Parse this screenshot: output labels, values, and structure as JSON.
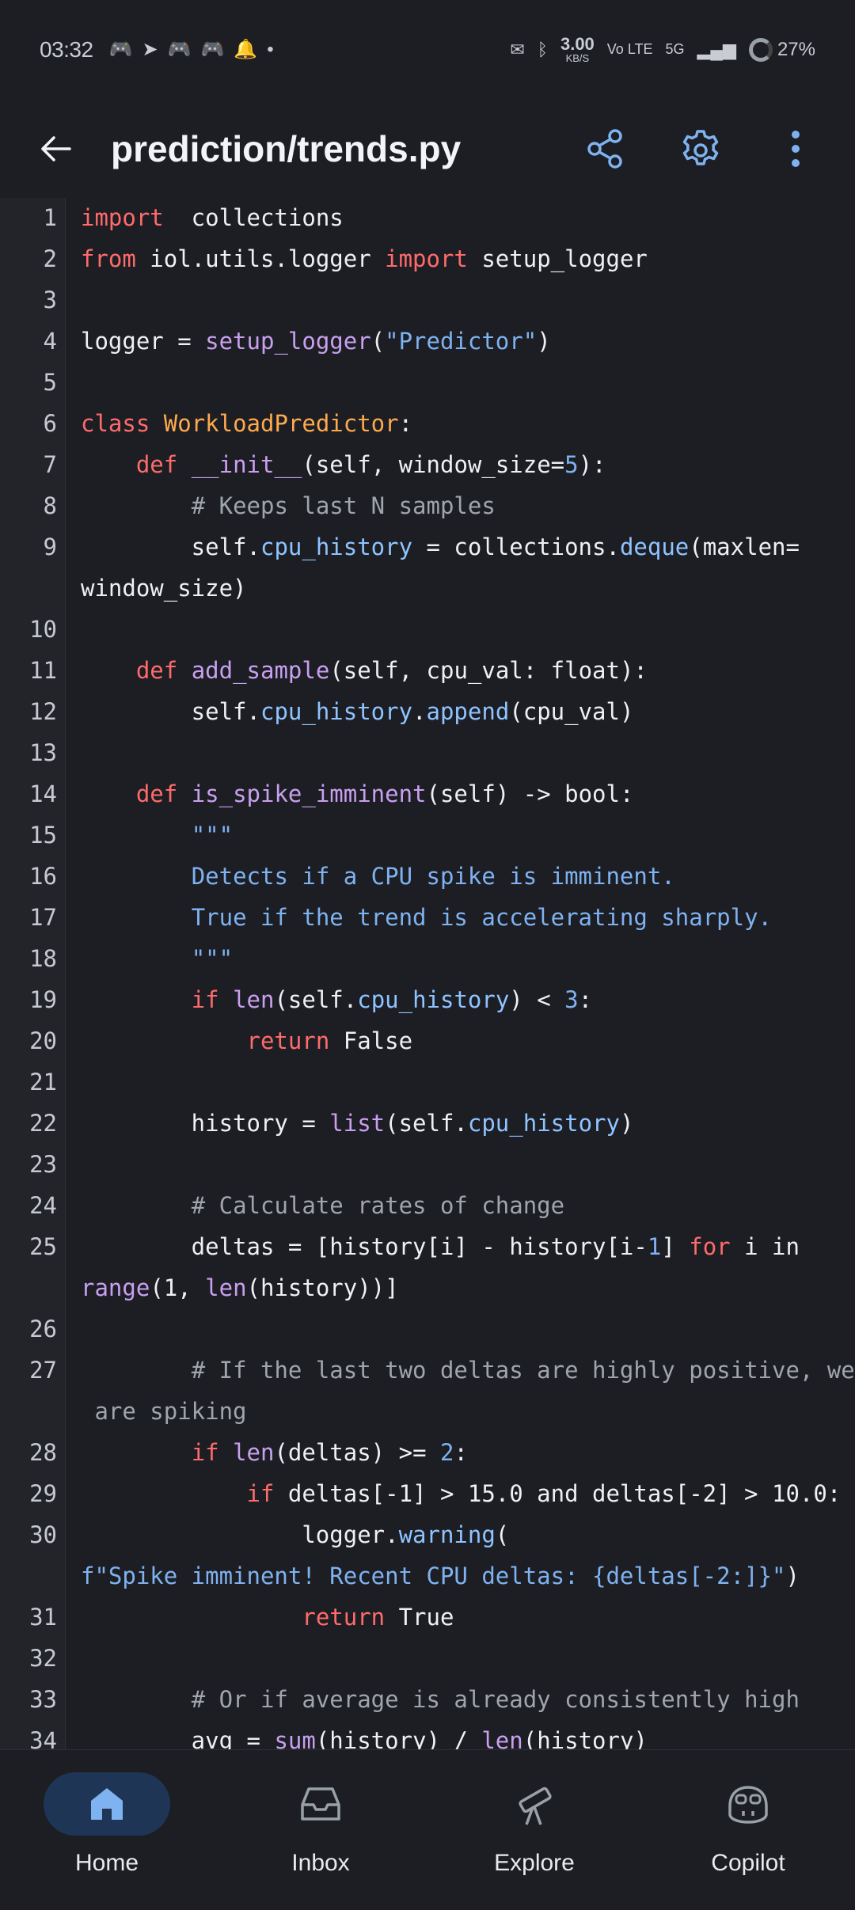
{
  "status_bar": {
    "time": "03:32",
    "net_speed": "3.00",
    "net_unit": "KB/S",
    "volte": "Vo LTE",
    "signal": "5G",
    "battery": "27%",
    "notification_icons": [
      "discord-icon",
      "telegram-icon",
      "discord-icon",
      "discord-icon",
      "bell-icon",
      "dot-icon"
    ]
  },
  "appbar": {
    "title": "prediction/trends.py"
  },
  "editor": {
    "lines": [
      {
        "n": "1",
        "segs": [
          [
            "kw",
            "import"
          ],
          [
            "",
            "  collections"
          ]
        ]
      },
      {
        "n": "2",
        "segs": [
          [
            "kw",
            "from"
          ],
          [
            "",
            " iol.utils.logger "
          ],
          [
            "kw",
            "import"
          ],
          [
            "",
            " setup_logger"
          ]
        ]
      },
      {
        "n": "3",
        "segs": []
      },
      {
        "n": "4",
        "segs": [
          [
            "",
            "logger = "
          ],
          [
            "fn",
            "setup_logger"
          ],
          [
            "",
            "("
          ],
          [
            "str",
            "\"Predictor\""
          ],
          [
            "",
            ")"
          ]
        ]
      },
      {
        "n": "5",
        "segs": []
      },
      {
        "n": "6",
        "segs": [
          [
            "kw",
            "class"
          ],
          [
            "",
            " "
          ],
          [
            "cls",
            "WorkloadPredictor"
          ],
          [
            "",
            ":"
          ]
        ]
      },
      {
        "n": "7",
        "segs": [
          [
            "",
            "    "
          ],
          [
            "kw",
            "def"
          ],
          [
            "",
            " "
          ],
          [
            "fn",
            "__init__"
          ],
          [
            "",
            "(self, window_size="
          ],
          [
            "num",
            "5"
          ],
          [
            "",
            "):"
          ]
        ]
      },
      {
        "n": "8",
        "segs": [
          [
            "",
            "        "
          ],
          [
            "cm",
            "# Keeps last N samples"
          ]
        ]
      },
      {
        "n": "9",
        "segs": [
          [
            "",
            "        self."
          ],
          [
            "attr",
            "cpu_history"
          ],
          [
            "",
            " = collections."
          ],
          [
            "attr",
            "deque"
          ],
          [
            "",
            "(maxlen="
          ]
        ],
        "cont": [
          [
            "",
            "window_size)"
          ]
        ]
      },
      {
        "n": "10",
        "segs": []
      },
      {
        "n": "11",
        "segs": [
          [
            "",
            "    "
          ],
          [
            "kw",
            "def"
          ],
          [
            "",
            " "
          ],
          [
            "fn",
            "add_sample"
          ],
          [
            "",
            "(self, cpu_val: float):"
          ]
        ]
      },
      {
        "n": "12",
        "segs": [
          [
            "",
            "        self."
          ],
          [
            "attr",
            "cpu_history"
          ],
          [
            "",
            "."
          ],
          [
            "attr",
            "append"
          ],
          [
            "",
            "(cpu_val)"
          ]
        ]
      },
      {
        "n": "13",
        "segs": []
      },
      {
        "n": "14",
        "segs": [
          [
            "",
            "    "
          ],
          [
            "kw",
            "def"
          ],
          [
            "",
            " "
          ],
          [
            "fn",
            "is_spike_imminent"
          ],
          [
            "",
            "(self) -> bool:"
          ]
        ]
      },
      {
        "n": "15",
        "segs": [
          [
            "",
            "        "
          ],
          [
            "str",
            "\"\"\""
          ]
        ]
      },
      {
        "n": "16",
        "segs": [
          [
            "",
            "        "
          ],
          [
            "str",
            "Detects if a CPU spike is imminent."
          ]
        ]
      },
      {
        "n": "17",
        "segs": [
          [
            "",
            "        "
          ],
          [
            "str",
            "True if the trend is accelerating sharply."
          ]
        ]
      },
      {
        "n": "18",
        "segs": [
          [
            "",
            "        "
          ],
          [
            "str",
            "\"\"\""
          ]
        ]
      },
      {
        "n": "19",
        "segs": [
          [
            "",
            "        "
          ],
          [
            "kw",
            "if"
          ],
          [
            "",
            " "
          ],
          [
            "fn",
            "len"
          ],
          [
            "",
            "(self."
          ],
          [
            "attr",
            "cpu_history"
          ],
          [
            "",
            ") < "
          ],
          [
            "num",
            "3"
          ],
          [
            "",
            ":"
          ]
        ]
      },
      {
        "n": "20",
        "segs": [
          [
            "",
            "            "
          ],
          [
            "kw",
            "return"
          ],
          [
            "",
            " False"
          ]
        ]
      },
      {
        "n": "21",
        "segs": []
      },
      {
        "n": "22",
        "segs": [
          [
            "",
            "        history = "
          ],
          [
            "fn",
            "list"
          ],
          [
            "",
            "(self."
          ],
          [
            "attr",
            "cpu_history"
          ],
          [
            "",
            ")"
          ]
        ]
      },
      {
        "n": "23",
        "segs": []
      },
      {
        "n": "24",
        "segs": [
          [
            "",
            "        "
          ],
          [
            "cm",
            "# Calculate rates of change"
          ]
        ]
      },
      {
        "n": "25",
        "segs": [
          [
            "",
            "        deltas = [history[i] - history[i-"
          ],
          [
            "num",
            "1"
          ],
          [
            "",
            "] "
          ],
          [
            "kw",
            "for"
          ],
          [
            "",
            " i in"
          ]
        ],
        "cont": [
          [
            "fn",
            "range"
          ],
          [
            "",
            "(1, "
          ],
          [
            "fn",
            "len"
          ],
          [
            "",
            "(history))]"
          ]
        ]
      },
      {
        "n": "26",
        "segs": []
      },
      {
        "n": "27",
        "segs": [
          [
            "",
            "        "
          ],
          [
            "cm",
            "# If the last two deltas are highly positive, we"
          ]
        ],
        "cont": [
          [
            "cm",
            " are spiking"
          ]
        ]
      },
      {
        "n": "28",
        "segs": [
          [
            "",
            "        "
          ],
          [
            "kw",
            "if"
          ],
          [
            "",
            " "
          ],
          [
            "fn",
            "len"
          ],
          [
            "",
            "(deltas) >= "
          ],
          [
            "num",
            "2"
          ],
          [
            "",
            ":"
          ]
        ]
      },
      {
        "n": "29",
        "segs": [
          [
            "",
            "            "
          ],
          [
            "kw",
            "if"
          ],
          [
            "",
            " deltas[-1] > 15.0 and deltas[-2] > 10.0:"
          ]
        ]
      },
      {
        "n": "30",
        "segs": [
          [
            "",
            "                logger."
          ],
          [
            "attr",
            "warning"
          ],
          [
            "",
            "("
          ]
        ],
        "cont": [
          [
            "str",
            "f\"Spike imminent! Recent CPU deltas: {deltas[-2:]}\""
          ],
          [
            "",
            ")"
          ]
        ]
      },
      {
        "n": "31",
        "segs": [
          [
            "",
            "                "
          ],
          [
            "kw",
            "return"
          ],
          [
            "",
            " True"
          ]
        ]
      },
      {
        "n": "32",
        "segs": []
      },
      {
        "n": "33",
        "segs": [
          [
            "",
            "        "
          ],
          [
            "cm",
            "# Or if average is already consistently high"
          ]
        ]
      },
      {
        "n": "34",
        "segs": [
          [
            "",
            "        avg = "
          ],
          [
            "fn",
            "sum"
          ],
          [
            "",
            "(history) / "
          ],
          [
            "fn",
            "len"
          ],
          [
            "",
            "(history)"
          ]
        ]
      }
    ]
  },
  "bottom_nav": {
    "items": [
      {
        "label": "Home",
        "icon": "home-icon",
        "active": true
      },
      {
        "label": "Inbox",
        "icon": "inbox-icon",
        "active": false
      },
      {
        "label": "Explore",
        "icon": "telescope-icon",
        "active": false
      },
      {
        "label": "Copilot",
        "icon": "copilot-icon",
        "active": false
      }
    ]
  },
  "colors": {
    "background": "#1c1e24",
    "accent": "#7fb2f0",
    "keyword": "#ff6b6b",
    "class": "#ffa94d",
    "function": "#c9a0f0",
    "comment": "#a0a4ac"
  }
}
